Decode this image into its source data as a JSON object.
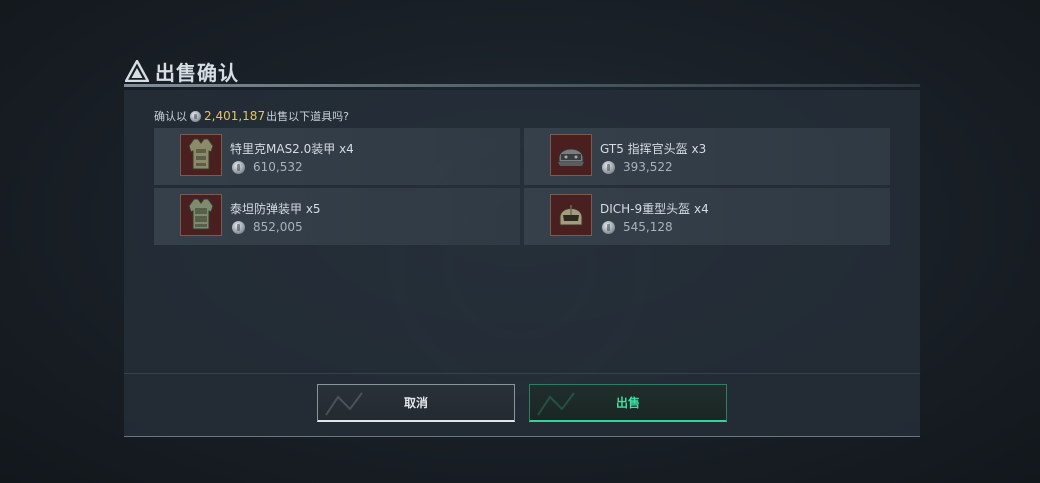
{
  "dialog": {
    "title": "出售确认",
    "prompt_prefix": "确认以",
    "prompt_amount": "2,401,187",
    "prompt_suffix": "出售以下道具吗?"
  },
  "items": [
    {
      "name": "特里克MAS2.0装甲 x4",
      "price": "610,532",
      "icon": "armor-vest-icon"
    },
    {
      "name": "GT5 指挥官头盔 x3",
      "price": "393,522",
      "icon": "commander-helmet-icon"
    },
    {
      "name": "泰坦防弹装甲 x5",
      "price": "852,005",
      "icon": "armor-vest-icon"
    },
    {
      "name": "DICH-9重型头盔 x4",
      "price": "545,128",
      "icon": "heavy-helmet-icon"
    }
  ],
  "buttons": {
    "cancel_label": "取消",
    "sell_label": "出售"
  },
  "colors": {
    "amount": "#e5c45a",
    "sell_accent": "#3fe0a2",
    "thumb_bg": "#4a1f20"
  }
}
